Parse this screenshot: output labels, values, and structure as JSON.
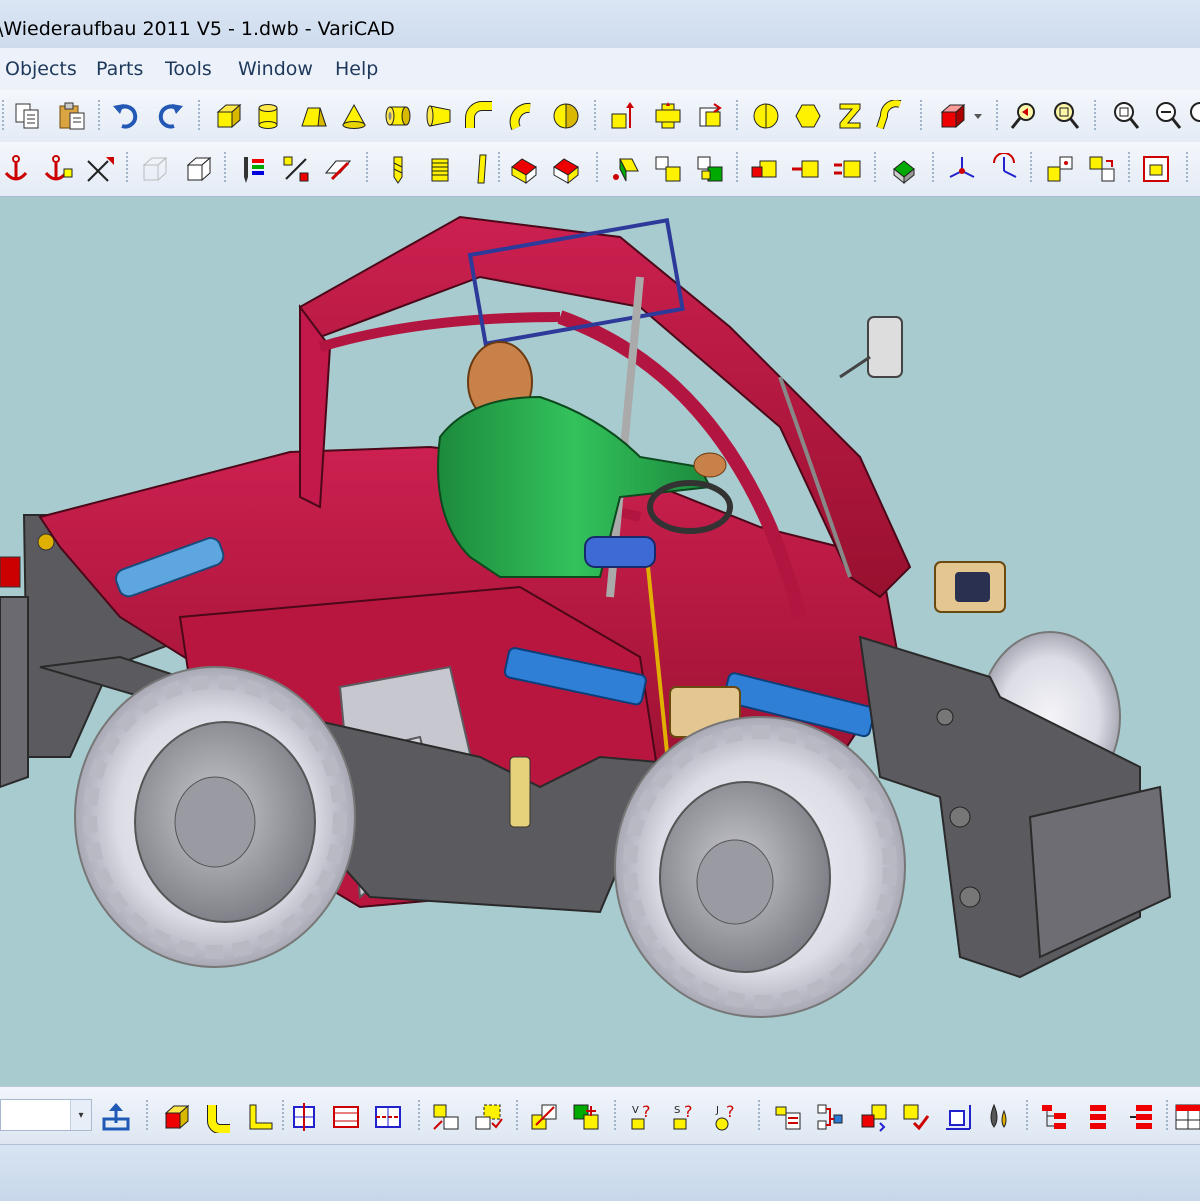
{
  "window": {
    "title": "\\Wiederaufbau 2011 V5 - 1.dwb - VariCAD"
  },
  "menu": {
    "items": [
      "Objects",
      "Parts",
      "Tools",
      "Window",
      "Help"
    ]
  },
  "toolbar_row1": {
    "icons": [
      "copy-icon",
      "paste-icon",
      "undo-icon",
      "redo-icon",
      "box-solid-icon",
      "cylinder-solid-icon",
      "pyramid-frustum-icon",
      "cone-solid-icon",
      "tube-solid-icon",
      "cone-frustum-icon",
      "pipe-elbow-icon",
      "torus-elbow-icon",
      "half-sphere-icon",
      "move-solid-icon",
      "add-solids-icon",
      "subtract-solids-icon",
      "cone-tool-icon",
      "prism-tool-icon",
      "z-profile-icon",
      "bend-profile-icon",
      "color-solid-icon",
      "zoom-previous-icon",
      "zoom-window-icon",
      "zoom-in-icon",
      "zoom-out-icon",
      "zoom-all-icon"
    ]
  },
  "toolbar_row2": {
    "icons": [
      "anchor-icon",
      "anchor-remove-icon",
      "cursor-cross-icon",
      "wireframe-box-icon",
      "outline-box-icon",
      "pen-colors-icon",
      "percent-tool-icon",
      "edit-profile-icon",
      "drill-icon",
      "thread-icon",
      "blade-icon",
      "shaded-box-icon",
      "hidden-box-icon",
      "solids-move-icon",
      "solids-copy-icon",
      "solids-array-icon",
      "insert-part-icon",
      "remove-part-icon",
      "replace-part-icon",
      "group-icon",
      "axes-3d-icon",
      "rotate-axes-icon",
      "align-icon",
      "transform-icon",
      "export-icon"
    ]
  },
  "bottom_toolbar": {
    "combo_value": "",
    "icons": [
      "upload-icon",
      "box-red-icon",
      "elbow-yellow-icon",
      "l-profile-icon",
      "cut-view-icon",
      "section-red-icon",
      "section-blue-icon",
      "measure-icon",
      "check-icon",
      "explode-icon",
      "attach-icon",
      "check-volume-icon",
      "check-surface-icon",
      "check-j-icon",
      "bom-icon",
      "assembly-tree-icon",
      "update-parts-icon",
      "check-parts-icon",
      "dimension-3d-icon",
      "material-icon",
      "tree-red-icon",
      "list-red-icon",
      "list-right-icon",
      "table-icon"
    ]
  },
  "colors": {
    "viewport_bg": "#a8cbcf",
    "body_red": "#b0163c",
    "frame_gray": "#5b5b5f",
    "tire": "#dcdce4",
    "seat_green": "#24a14a"
  }
}
